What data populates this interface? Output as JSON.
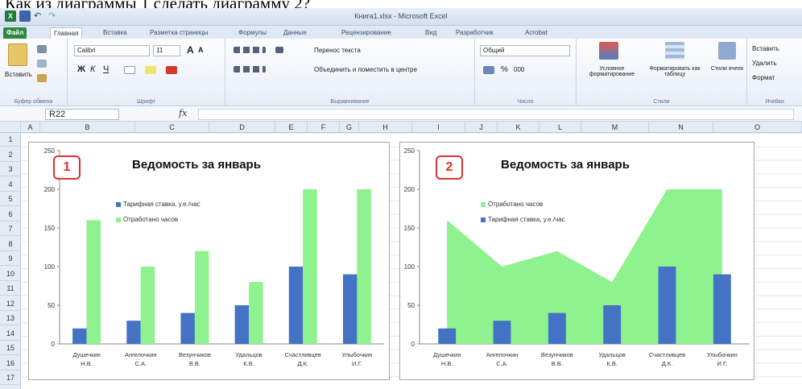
{
  "caption": "Как из диаграммы 1 сделать диаграмму 2?",
  "window": {
    "title": "Книга1.xlsx - Microsoft Excel"
  },
  "quick_access": {
    "app_icon": "excel-icon",
    "save_icon": "save-icon",
    "undo_icon": "undo-icon",
    "redo_icon": "redo-icon"
  },
  "tabs": [
    "Файл",
    "Главная",
    "Вставка",
    "Разметка страницы",
    "Формулы",
    "Данные",
    "Рецензирование",
    "Вид",
    "Разработчик",
    "Acrobat"
  ],
  "ribbon": {
    "clipboard": {
      "paste": "Вставить",
      "label": "Буфер обмена"
    },
    "font": {
      "name": "Calibri",
      "size": "11",
      "bold": "Ж",
      "italic": "К",
      "underline": "Ч",
      "grow": "A",
      "shrink": "A",
      "label": "Шрифт"
    },
    "alignment": {
      "wrap": "Перенос текста",
      "merge": "Объединить и поместить в центре",
      "label": "Выравнивание"
    },
    "number": {
      "format": "Общий",
      "percent": "%",
      "thousands": "000",
      "label": "Число"
    },
    "styles": {
      "conditional": "Условное форматирование",
      "as_table": "Форматировать как таблицу",
      "cell_styles": "Стили ячеек",
      "label": "Стили"
    },
    "cells": {
      "insert": "Вставить",
      "delete": "Удалить",
      "format": "Формат",
      "label": "Ячейки"
    }
  },
  "formula_bar": {
    "name_box": "R22",
    "fx": "fx",
    "value": ""
  },
  "columns": [
    "A",
    "B",
    "C",
    "D",
    "E",
    "F",
    "G",
    "H",
    "I",
    "J",
    "K",
    "L",
    "M",
    "N",
    "O"
  ],
  "rows": [
    "1",
    "2",
    "3",
    "4",
    "5",
    "6",
    "7",
    "8",
    "9",
    "10",
    "11",
    "12",
    "13",
    "14",
    "15",
    "16",
    "17"
  ],
  "cell_fragment": "N",
  "colors": {
    "blue": "#4472c4",
    "green": "#8ef28e",
    "badge": "#e03030"
  },
  "chart_data": [
    {
      "type": "bar",
      "badge": "1",
      "title": "Ведомость за январь",
      "categories": [
        "Душечкин Н.В.",
        "Ангелочкин С.А.",
        "Везунчиков В.В.",
        "Удальцов К.В.",
        "Счастливцев Д.К.",
        "Улыбочкин И.Г."
      ],
      "series": [
        {
          "name": "Тарифная ставка, у.е./час",
          "values": [
            20,
            30,
            40,
            50,
            100,
            90
          ],
          "color": "#4472c4"
        },
        {
          "name": "Отработано часов",
          "values": [
            160,
            100,
            120,
            80,
            200,
            200
          ],
          "color": "#8ef28e"
        }
      ],
      "yticks": [
        "0",
        "50",
        "100",
        "150",
        "200",
        "250"
      ],
      "ylim": [
        0,
        250
      ],
      "legend": "top-left"
    },
    {
      "type": "area",
      "badge": "2",
      "title": "Ведомость за январь",
      "categories": [
        "Душечкин Н.В.",
        "Ангелочкин С.А.",
        "Везунчиков В.В.",
        "Удальцов К.В.",
        "Счастливцев Д.К.",
        "Улыбочкин И.Г."
      ],
      "series": [
        {
          "name": "Отработано часов",
          "values": [
            160,
            100,
            120,
            80,
            200,
            200
          ],
          "color": "#8ef28e",
          "render": "area"
        },
        {
          "name": "Тарифная ставка, у.е./час",
          "values": [
            20,
            30,
            40,
            50,
            100,
            90
          ],
          "color": "#4472c4",
          "render": "bar"
        }
      ],
      "yticks": [
        "0",
        "50",
        "100",
        "150",
        "200",
        "250"
      ],
      "ylim": [
        0,
        250
      ],
      "legend": "top-left"
    }
  ]
}
